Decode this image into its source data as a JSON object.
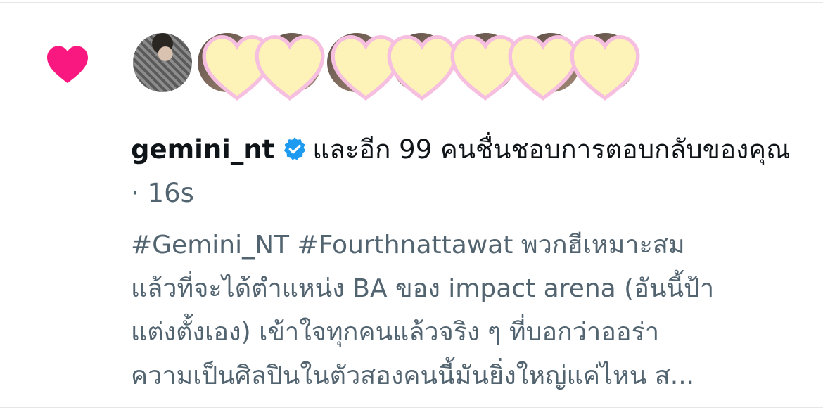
{
  "notification": {
    "type_icon": "heart-icon",
    "liker_name": "gemini_nt",
    "verified_icon": "verified-badge-icon",
    "summary_text": "และอีก 99 คนชื่นชอบการตอบกลับของคุณ",
    "separator": "·",
    "timestamp": "16s",
    "tweet_text": "#Gemini_NT #Fourthnattawat พวกฮีเหมาะสม\nแล้วที่จะได้ตำแหน่ง BA ของ impact arena (อันนี้ป้า\nแต่งตั้งเอง) เข้าใจทุกคนแล้วจริง ๆ ที่บอกว่าออร่า\nความเป็นศิลปินในตัวสองคนนี้มันยิ่งใหญ่แค่ไหน ส..."
  },
  "colors": {
    "heart": "#f91880",
    "verified": "#1d9bf0",
    "text_primary": "#0f1419",
    "text_secondary": "#536471",
    "sticker_fill": "#fdf3b8",
    "sticker_outline": "#f6bfe0"
  },
  "avatars": {
    "count": 9,
    "covered_by_heart_stickers": 8
  }
}
